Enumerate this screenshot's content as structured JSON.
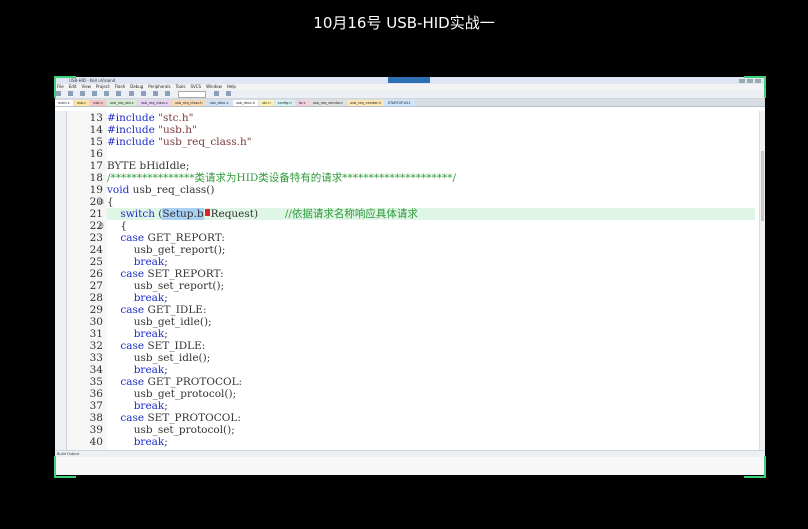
{
  "video_title": "10月16号 USB-HID实战一",
  "ide": {
    "window_title": "USB-HID - Keil uVision4",
    "menu_items": [
      "File",
      "Edit",
      "View",
      "Project",
      "Flash",
      "Debug",
      "Peripherals",
      "Tools",
      "SVCS",
      "Window",
      "Help"
    ],
    "toolbar_target": "target",
    "tabs": [
      {
        "label": "main.c",
        "color": "#ffffff"
      },
      {
        "label": "usb.c",
        "color": "#fce6a6"
      },
      {
        "label": "usb.h",
        "color": "#f7c7c7"
      },
      {
        "label": "usb_req_std.c",
        "color": "#d8ecd0"
      },
      {
        "label": "usb_req_class.c",
        "color": "#e9d2f2"
      },
      {
        "label": "usb_req_class.h",
        "color": "#fbd9b3"
      },
      {
        "label": "usb_desc.c",
        "color": "#cfe3f7"
      },
      {
        "label": "usb_desc.h",
        "color": "#ffffff"
      },
      {
        "label": "stc.h",
        "color": "#fdf3b0"
      },
      {
        "label": "config.h",
        "color": "#d6f2f0"
      },
      {
        "label": "isr.c",
        "color": "#f2d0dc"
      },
      {
        "label": "usb_req_vendor.c",
        "color": "#e1e1e1"
      },
      {
        "label": "usb_req_vendor.h",
        "color": "#fde7b4"
      },
      {
        "label": "STARTUP.A51",
        "color": "#cbe6ff"
      }
    ],
    "status_text": "Build Output"
  },
  "code_lines": [
    {
      "num": "13",
      "tokens": [
        {
          "t": "#include ",
          "c": "pp"
        },
        {
          "t": "\"stc.h\"",
          "c": "str"
        }
      ]
    },
    {
      "num": "14",
      "tokens": [
        {
          "t": "#include ",
          "c": "pp"
        },
        {
          "t": "\"usb.h\"",
          "c": "str"
        }
      ]
    },
    {
      "num": "15",
      "tokens": [
        {
          "t": "#include ",
          "c": "pp"
        },
        {
          "t": "\"usb_req_class.h\"",
          "c": "str"
        }
      ]
    },
    {
      "num": "16",
      "tokens": []
    },
    {
      "num": "17",
      "tokens": [
        {
          "t": "BYTE bHidIdle;",
          "c": ""
        }
      ]
    },
    {
      "num": "18",
      "tokens": [
        {
          "t": "/****************类请求为HID类设备特有的请求*********************/",
          "c": "cmt"
        }
      ]
    },
    {
      "num": "19",
      "tokens": [
        {
          "t": "void",
          "c": "kw"
        },
        {
          "t": " usb_req_class()",
          "c": ""
        }
      ]
    },
    {
      "num": "20",
      "fold": "⊟",
      "tokens": [
        {
          "t": "{",
          "c": ""
        }
      ]
    },
    {
      "num": "21",
      "hl": true,
      "tokens": [
        {
          "t": "    ",
          "c": ""
        },
        {
          "t": "switch",
          "c": "kw"
        },
        {
          "t": " (",
          "c": ""
        },
        {
          "t": "Setup.b",
          "c": "sel"
        },
        {
          "t": "",
          "c": "cursor"
        },
        {
          "t": "Request)        ",
          "c": ""
        },
        {
          "t": "//依据请求名称响应具体请求",
          "c": "cmt"
        }
      ]
    },
    {
      "num": "22",
      "fold": "⊟",
      "tokens": [
        {
          "t": "    {",
          "c": ""
        }
      ]
    },
    {
      "num": "23",
      "tokens": [
        {
          "t": "    ",
          "c": ""
        },
        {
          "t": "case",
          "c": "kw"
        },
        {
          "t": " GET_REPORT:",
          "c": ""
        }
      ]
    },
    {
      "num": "24",
      "tokens": [
        {
          "t": "        usb_get_report();",
          "c": ""
        }
      ]
    },
    {
      "num": "25",
      "tokens": [
        {
          "t": "        ",
          "c": ""
        },
        {
          "t": "break",
          "c": "kw"
        },
        {
          "t": ";",
          "c": ""
        }
      ]
    },
    {
      "num": "26",
      "tokens": [
        {
          "t": "    ",
          "c": ""
        },
        {
          "t": "case",
          "c": "kw"
        },
        {
          "t": " SET_REPORT:",
          "c": ""
        }
      ]
    },
    {
      "num": "27",
      "tokens": [
        {
          "t": "        usb_set_report();",
          "c": ""
        }
      ]
    },
    {
      "num": "28",
      "tokens": [
        {
          "t": "        ",
          "c": ""
        },
        {
          "t": "break",
          "c": "kw"
        },
        {
          "t": ";",
          "c": ""
        }
      ]
    },
    {
      "num": "29",
      "tokens": [
        {
          "t": "    ",
          "c": ""
        },
        {
          "t": "case",
          "c": "kw"
        },
        {
          "t": " GET_IDLE:",
          "c": ""
        }
      ]
    },
    {
      "num": "30",
      "tokens": [
        {
          "t": "        usb_get_idle();",
          "c": ""
        }
      ]
    },
    {
      "num": "31",
      "tokens": [
        {
          "t": "        ",
          "c": ""
        },
        {
          "t": "break",
          "c": "kw"
        },
        {
          "t": ";",
          "c": ""
        }
      ]
    },
    {
      "num": "32",
      "tokens": [
        {
          "t": "    ",
          "c": ""
        },
        {
          "t": "case",
          "c": "kw"
        },
        {
          "t": " SET_IDLE:",
          "c": ""
        }
      ]
    },
    {
      "num": "33",
      "tokens": [
        {
          "t": "        usb_set_idle();",
          "c": ""
        }
      ]
    },
    {
      "num": "34",
      "tokens": [
        {
          "t": "        ",
          "c": ""
        },
        {
          "t": "break",
          "c": "kw"
        },
        {
          "t": ";",
          "c": ""
        }
      ]
    },
    {
      "num": "35",
      "tokens": [
        {
          "t": "    ",
          "c": ""
        },
        {
          "t": "case",
          "c": "kw"
        },
        {
          "t": " GET_PROTOCOL:",
          "c": ""
        }
      ]
    },
    {
      "num": "36",
      "tokens": [
        {
          "t": "        usb_get_protocol();",
          "c": ""
        }
      ]
    },
    {
      "num": "37",
      "tokens": [
        {
          "t": "        ",
          "c": ""
        },
        {
          "t": "break",
          "c": "kw"
        },
        {
          "t": ";",
          "c": ""
        }
      ]
    },
    {
      "num": "38",
      "tokens": [
        {
          "t": "    ",
          "c": ""
        },
        {
          "t": "case",
          "c": "kw"
        },
        {
          "t": " SET_PROTOCOL:",
          "c": ""
        }
      ]
    },
    {
      "num": "39",
      "tokens": [
        {
          "t": "        usb_set_protocol();",
          "c": ""
        }
      ]
    },
    {
      "num": "40",
      "tokens": [
        {
          "t": "        ",
          "c": ""
        },
        {
          "t": "break",
          "c": "kw"
        },
        {
          "t": ";",
          "c": ""
        }
      ]
    }
  ],
  "colors": {
    "keyword": "#1e2fc9",
    "comment": "#2f9a3a",
    "string": "#7a3a3a",
    "current_line": "#dff5e6",
    "selection": "#aad0f3",
    "frame_corners": "#3fd17a"
  }
}
